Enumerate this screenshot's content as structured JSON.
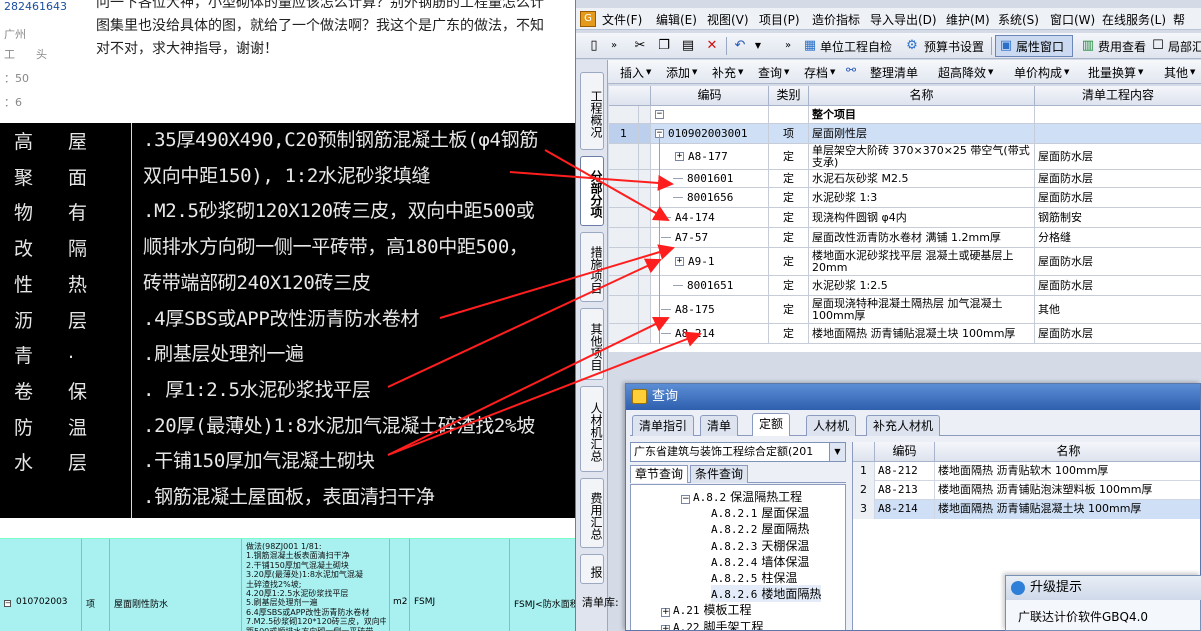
{
  "forum": {
    "user_id": "282461643",
    "region": "广州",
    "title_a": "工",
    "title_b": "头",
    "stat_1": "：50",
    "stat_2": "：6",
    "post_line_1": "问一下各位大神，小型砌体的量应该怎么计算？别外钢筋的工程量怎么计",
    "post_line_2": "图集里也没给具体的图，就给了一个做法啊？我这个是广东的做法，不知",
    "post_line_3": "对不对，求大神指导，谢谢！"
  },
  "cad": {
    "left_col_1": [
      "高",
      "聚",
      "物",
      "改",
      "性",
      "沥",
      "青",
      "卷",
      "防",
      "水"
    ],
    "left_col_2": [
      "屋",
      "面",
      "有",
      "隔",
      "热",
      "层",
      ".",
      "保",
      "温",
      "层"
    ],
    "lines": [
      ".35厚490X490,C20预制钢筋混凝土板(φ4钢筋",
      " 双向中距150), 1:2水泥砂浆填缝",
      ".M2.5砂浆砌120X120砖三皮，双向中距500或",
      " 顺排水方向砌一侧一平砖带，高180中距500，",
      " 砖带端部砌240X120砖三皮",
      ".4厚SBS或APP改性沥青防水卷材",
      ".刷基层处理剂一遍",
      ".   厚1:2.5水泥砂浆找平层",
      ".20厚(最薄处)1:8水泥加气混凝土碎渣找2%坡",
      ".干铺150厚加气混凝土砌块",
      ".钢筋混凝土屋面板，表面清扫干净"
    ]
  },
  "strip": {
    "code": "010702003",
    "type": "项",
    "name": "屋面刚性防水",
    "unit": "m2",
    "formula": "FSMJ",
    "expr": "FSMJ<防水面积>",
    "method_lines": [
      "做法(98ZJ001 1/81:",
      "1.钢筋混凝土板表面清扫干净",
      "2.干铺150厚加气混凝土砌块",
      "3.20厚(最薄处)1:8水泥加气混凝",
      "土碎渣找2%坡;",
      "4.20厚1:2.5水泥砂浆找平层",
      "5.刷基层处理剂一遍",
      "6.4厚SBS或APP改性沥青防水卷材",
      "7.M2.5砂浆砌120*120砖三皮，双向中",
      "距500或顺排水方向砌一侧一平砖带",
      "，高180中距500，砖带端部砌240*12"
    ]
  },
  "gbq": {
    "menu": [
      "文件(F)",
      "编辑(E)",
      "视图(V)",
      "项目(P)",
      "造价指标",
      "导入导出(D)",
      "维护(M)",
      "系统(S)",
      "窗口(W)",
      "在线服务(L)",
      "帮"
    ],
    "toolbar1": {
      "unit_check": "单位工程自检",
      "budget_settings": "预算书设置",
      "property_window": "属性窗口",
      "cost_view": "费用查看",
      "local": "局部汇"
    },
    "toolbar2": [
      "插入",
      "添加",
      "补充",
      "查询",
      "存档",
      "整理清单",
      "超高降效",
      "单价构成",
      "批量换算",
      "其他"
    ],
    "vtabs": [
      "工程概况",
      "分部分项",
      "措施项目",
      "其他项目",
      "人材机汇总",
      "费用汇总",
      "报"
    ],
    "grid_headers": [
      "编码",
      "类别",
      "名称",
      "清单工程内容"
    ],
    "rows": [
      {
        "num": "",
        "code": "",
        "type": "",
        "name": "整个项目",
        "content": ""
      },
      {
        "num": "1",
        "code": "010902003001",
        "type": "项",
        "name": "屋面刚性层",
        "content": ""
      },
      {
        "num": "",
        "code": "A8-177",
        "type": "定",
        "name": "单层架空大阶砖 370×370×25 带空气(带式支承)",
        "content": "屋面防水层"
      },
      {
        "num": "",
        "code": "8001601",
        "type": "定",
        "name": "水泥石灰砂浆 M2.5",
        "content": "屋面防水层"
      },
      {
        "num": "",
        "code": "8001656",
        "type": "定",
        "name": "水泥砂浆 1:3",
        "content": "屋面防水层"
      },
      {
        "num": "",
        "code": "A4-174",
        "type": "定",
        "name": "现浇构件圆钢 φ4内",
        "content": "钢筋制安"
      },
      {
        "num": "",
        "code": "A7-57",
        "type": "定",
        "name": "屋面改性沥青防水卷材 满铺 1.2mm厚",
        "content": "分格缝"
      },
      {
        "num": "",
        "code": "A9-1",
        "type": "定",
        "name": "楼地面水泥砂浆找平层 混凝土或硬基层上 20mm",
        "content": "屋面防水层"
      },
      {
        "num": "",
        "code": "8001651",
        "type": "定",
        "name": "水泥砂浆 1:2.5",
        "content": "屋面防水层"
      },
      {
        "num": "",
        "code": "A8-175",
        "type": "定",
        "name": "屋面现浇特种混凝土隔热层 加气混凝土 100mm厚",
        "content": "其他"
      },
      {
        "num": "",
        "code": "A8-214",
        "type": "定",
        "name": "楼地面隔热 沥青铺贴混凝土块 100mm厚",
        "content": "屋面防水层"
      }
    ],
    "status_label": "清单库:"
  },
  "query": {
    "title": "查询",
    "tabs": [
      "清单指引",
      "清单",
      "定额",
      "人材机",
      "补充人材机"
    ],
    "active_tab": "定额",
    "library": "广东省建筑与装饰工程综合定额(201",
    "subtabs": [
      "章节查询",
      "条件查询"
    ],
    "tree": [
      {
        "code": "A.8.2",
        "label": "保温隔热工程",
        "level": 1
      },
      {
        "code": "A.8.2.1",
        "label": "屋面保温",
        "level": 2
      },
      {
        "code": "A.8.2.2",
        "label": "屋面隔热",
        "level": 2
      },
      {
        "code": "A.8.2.3",
        "label": "天棚保温",
        "level": 2
      },
      {
        "code": "A.8.2.4",
        "label": "墙体保温",
        "level": 2
      },
      {
        "code": "A.8.2.5",
        "label": "柱保温",
        "level": 2
      },
      {
        "code": "A.8.2.6",
        "label": "楼地面隔热",
        "level": 2
      },
      {
        "code": "A.21",
        "label": "模板工程",
        "level": 0
      },
      {
        "code": "A.22",
        "label": "脚手架工程",
        "level": 0
      }
    ],
    "result_headers": [
      "编码",
      "名称"
    ],
    "results": [
      {
        "num": "1",
        "code": "A8-212",
        "name": "楼地面隔热 沥青贴软木 100mm厚"
      },
      {
        "num": "2",
        "code": "A8-213",
        "name": "楼地面隔热 沥青铺贴泡沫塑料板 100mm厚"
      },
      {
        "num": "3",
        "code": "A8-214",
        "name": "楼地面隔热 沥青铺贴混凝土块 100mm厚"
      }
    ]
  },
  "upgrade": {
    "title": "升级提示",
    "body": "广联达计价软件GBQ4.0"
  },
  "colors": {
    "arrow": "#ff1e1e",
    "selection": "#cfe0f6",
    "cad_bg": "#000000",
    "strip_bg": "#a9f1f1"
  }
}
